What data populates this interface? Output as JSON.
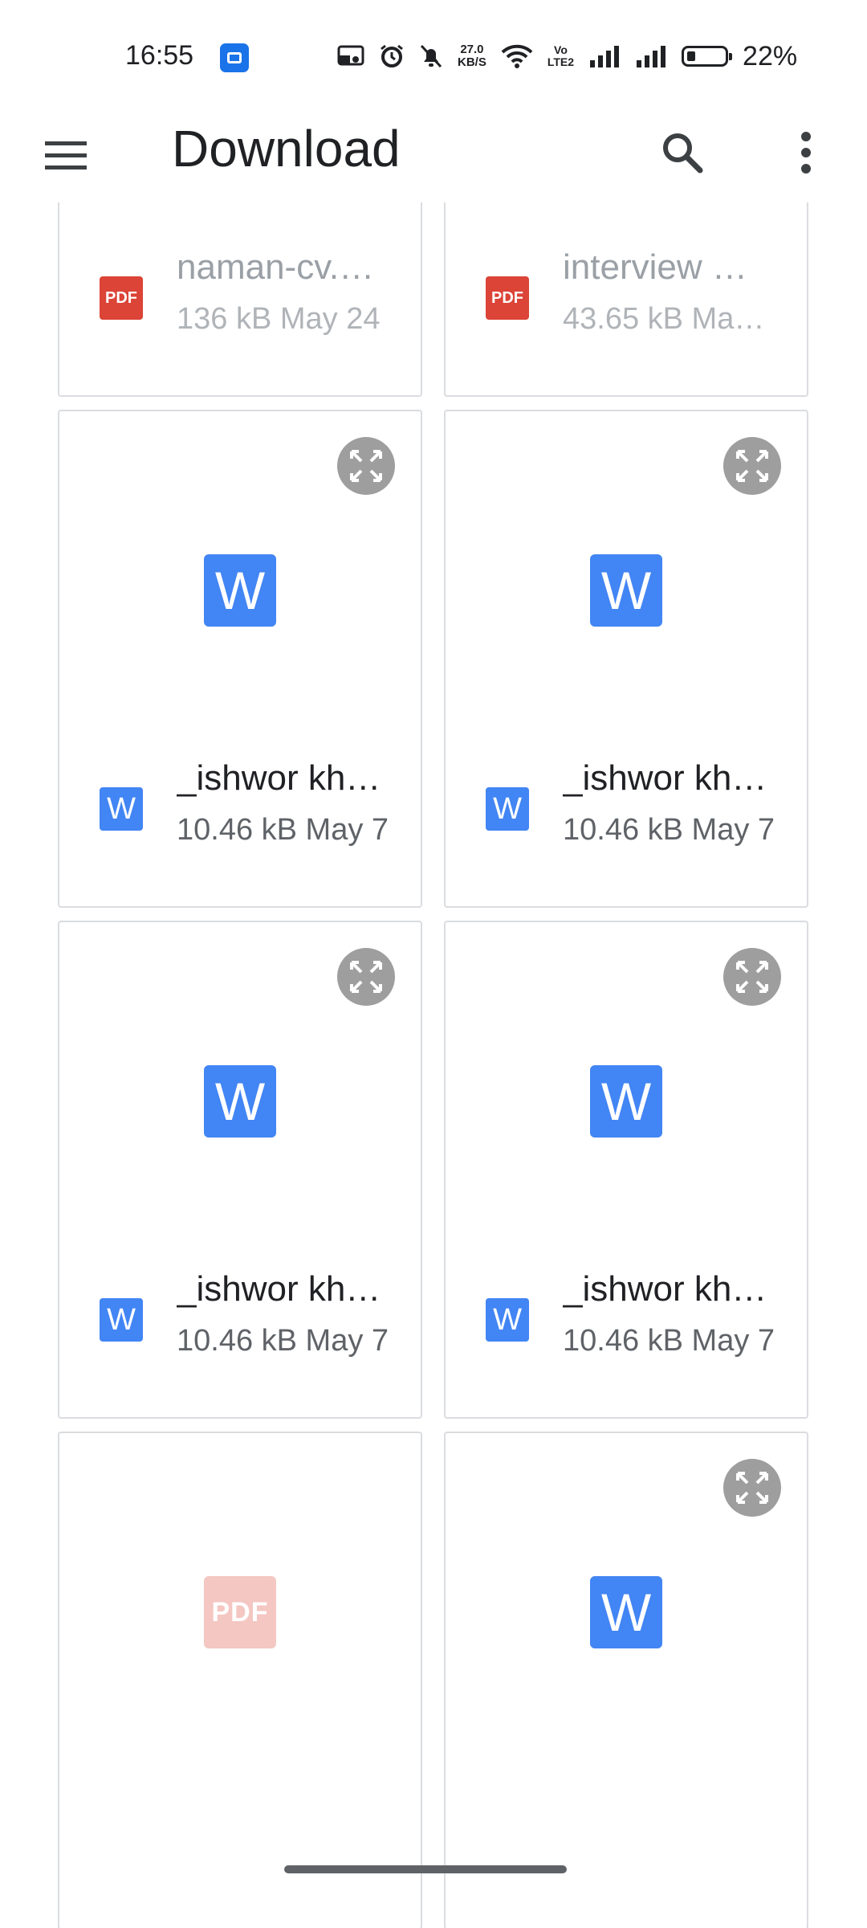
{
  "status_bar": {
    "time": "16:55",
    "net_speed_value": "27.0",
    "net_speed_unit": "KB/S",
    "volte_top": "Vo",
    "volte_bottom": "LTE2",
    "battery_percent": "22%",
    "battery_level": 0.22,
    "icons": [
      "app-notification-icon",
      "cast-icon",
      "alarm-icon",
      "mute-icon",
      "wifi-icon",
      "signal-icon",
      "signal-icon",
      "battery-icon"
    ]
  },
  "app_bar": {
    "title": "Download",
    "icons": [
      "menu-icon",
      "search-icon",
      "more-vert-icon"
    ]
  },
  "files": [
    {
      "type": "pdf",
      "thumb_label": "PDF",
      "type_label": "PDF",
      "name": "naman-cv.…",
      "meta": "136 kB May 24",
      "expandable": false,
      "dim": true
    },
    {
      "type": "pdf",
      "thumb_label": "PDF",
      "type_label": "PDF",
      "name": "interview …",
      "meta": "43.65 kB Ma…",
      "expandable": false,
      "dim": true
    },
    {
      "type": "word",
      "thumb_label": "W",
      "type_label": "W",
      "name": "_ishwor kh…",
      "meta": "10.46 kB May 7",
      "expandable": true,
      "dim": false
    },
    {
      "type": "word",
      "thumb_label": "W",
      "type_label": "W",
      "name": "_ishwor kh…",
      "meta": "10.46 kB May 7",
      "expandable": true,
      "dim": false
    },
    {
      "type": "word",
      "thumb_label": "W",
      "type_label": "W",
      "name": "_ishwor kh…",
      "meta": "10.46 kB May 7",
      "expandable": true,
      "dim": false
    },
    {
      "type": "word",
      "thumb_label": "W",
      "type_label": "W",
      "name": "_ishwor kh…",
      "meta": "10.46 kB May 7",
      "expandable": true,
      "dim": false
    },
    {
      "type": "pdf",
      "thumb_label": "PDF",
      "type_label": "PDF",
      "name": "",
      "meta": "",
      "expandable": false,
      "dim": false
    },
    {
      "type": "word",
      "thumb_label": "W",
      "type_label": "W",
      "name": "",
      "meta": "",
      "expandable": true,
      "dim": false
    }
  ],
  "colors": {
    "word_blue": "#4285f4",
    "pdf_red": "#db4437",
    "pdf_thumb_pink": "#f4c7c3",
    "card_border": "#dadce0",
    "expand_badge": "#9e9e9e"
  }
}
